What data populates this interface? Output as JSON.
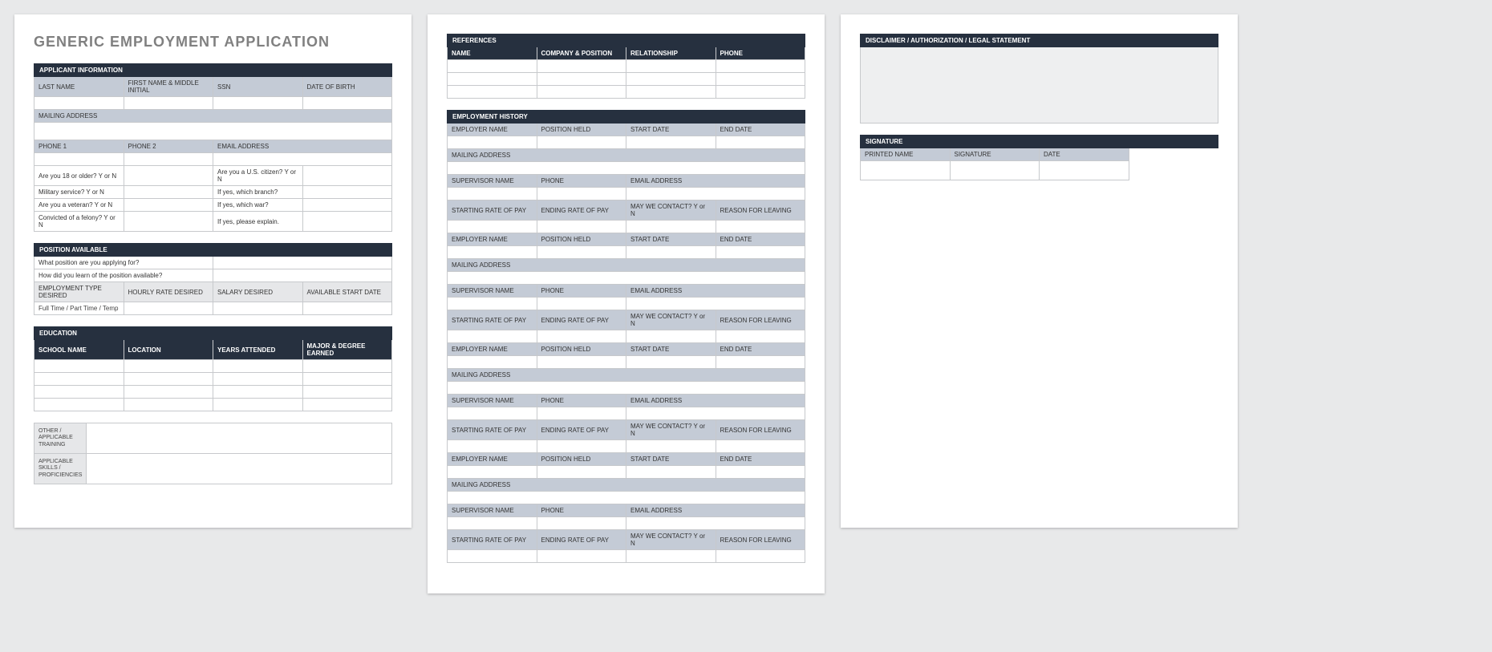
{
  "title": "GENERIC EMPLOYMENT APPLICATION",
  "applicant": {
    "section": "APPLICANT INFORMATION",
    "last_name": "LAST NAME",
    "first_name": "FIRST NAME & MIDDLE INITIAL",
    "ssn": "SSN",
    "dob": "DATE OF BIRTH",
    "mailing": "MAILING ADDRESS",
    "phone1": "PHONE 1",
    "phone2": "PHONE 2",
    "email": "EMAIL ADDRESS",
    "q_18": "Are you 18 or older?   Y  or  N",
    "q_citizen": "Are you a U.S. citizen?   Y  or  N",
    "q_military": "Military service?   Y  or  N",
    "q_branch": "If yes, which branch?",
    "q_veteran": "Are you a veteran?   Y  or  N",
    "q_war": "If yes, which war?",
    "q_felony": "Convicted of a felony?   Y  or  N",
    "q_explain": "If yes, please explain."
  },
  "position": {
    "section": "POSITION AVAILABLE",
    "q_pos": "What position are you applying for?",
    "q_learn": "How did you learn of the position available?",
    "emp_type": "EMPLOYMENT TYPE DESIRED",
    "hourly": "HOURLY RATE DESIRED",
    "salary": "SALARY DESIRED",
    "start": "AVAILABLE START DATE",
    "emp_type_val": "Full Time / Part Time / Temp"
  },
  "education": {
    "section": "EDUCATION",
    "school": "SCHOOL NAME",
    "location": "LOCATION",
    "years": "YEARS ATTENDED",
    "major": "MAJOR & DEGREE EARNED",
    "other_training": "OTHER / APPLICABLE TRAINING",
    "skills": "APPLICABLE SKILLS / PROFICIENCIES"
  },
  "references": {
    "section": "REFERENCES",
    "name": "NAME",
    "company": "COMPANY & POSITION",
    "relationship": "RELATIONSHIP",
    "phone": "PHONE"
  },
  "history": {
    "section": "EMPLOYMENT HISTORY",
    "employer": "EMPLOYER NAME",
    "position": "POSITION HELD",
    "start": "START DATE",
    "end": "END DATE",
    "mailing": "MAILING ADDRESS",
    "supervisor": "SUPERVISOR NAME",
    "phone": "PHONE",
    "email": "EMAIL ADDRESS",
    "start_pay": "STARTING RATE OF PAY",
    "end_pay": "ENDING RATE OF PAY",
    "contact": "MAY WE CONTACT? Y or N",
    "reason": "REASON FOR LEAVING"
  },
  "disclaimer": {
    "section": "DISCLAIMER / AUTHORIZATION / LEGAL STATEMENT"
  },
  "signature": {
    "section": "SIGNATURE",
    "printed": "PRINTED NAME",
    "sig": "SIGNATURE",
    "date": "DATE"
  }
}
